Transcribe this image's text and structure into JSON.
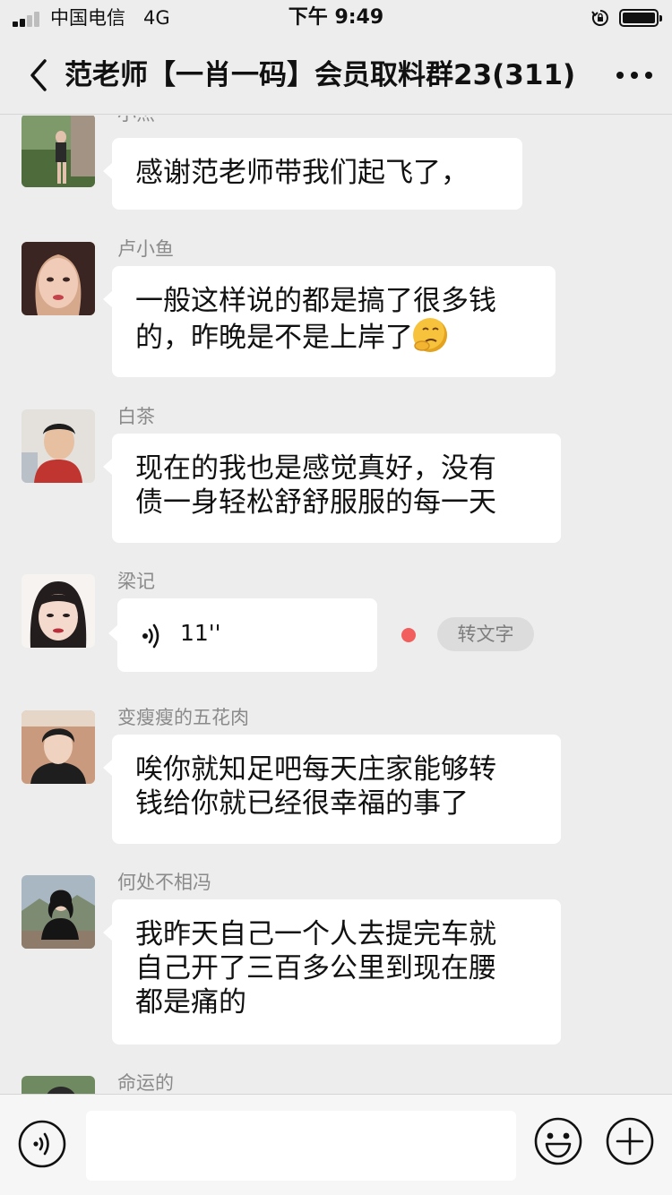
{
  "status_bar": {
    "carrier": "中国电信",
    "network": "4G",
    "time": "下午 9:49"
  },
  "header": {
    "title": "范老师【一肖一码】会员取料群23(311)",
    "back_icon": "chevron-left-icon",
    "more_icon": "more-dots-icon"
  },
  "messages": [
    {
      "sender": "小杰",
      "text": "感谢范老师带我们起飞了，",
      "avatar_colors": [
        "#5b7a4a",
        "#c9b8a8"
      ]
    },
    {
      "sender": "卢小鱼",
      "line1": "一般这样说的都是搞了很多钱",
      "line2": "的，昨晚是不是上岸了",
      "emoji": "thinking-face-emoji",
      "avatar_colors": [
        "#3a2a2a",
        "#e8b9a8"
      ]
    },
    {
      "sender": "白茶",
      "line1": "现在的我也是感觉真好，没有",
      "line2": "债一身轻松舒舒服服的每一天",
      "avatar_colors": [
        "#d9d4cf",
        "#b06a4a"
      ]
    },
    {
      "sender": "梁记",
      "voice_duration": "11''",
      "transcribe_label": "转文字",
      "avatar_colors": [
        "#ffffff",
        "#2a2222"
      ]
    },
    {
      "sender": "变瘦瘦的五花肉",
      "line1": "唉你就知足吧每天庄家能够转",
      "line2": "钱给你就已经很幸福的事了",
      "avatar_colors": [
        "#b88a6a",
        "#222222"
      ]
    },
    {
      "sender": "何处不相冯",
      "line1": "我昨天自己一个人去提完车就",
      "line2": "自己开了三百多公里到现在腰",
      "line3": "都是痛的",
      "avatar_colors": [
        "#8a9aa8",
        "#1a1a1a"
      ]
    },
    {
      "sender": "命运的",
      "avatar_colors": [
        "#6a8a5a",
        "#2a2a2a"
      ]
    }
  ],
  "input_bar": {
    "input_value": "",
    "voice_icon": "voice-icon",
    "emoji_icon": "smiley-icon",
    "plus_icon": "plus-icon"
  }
}
